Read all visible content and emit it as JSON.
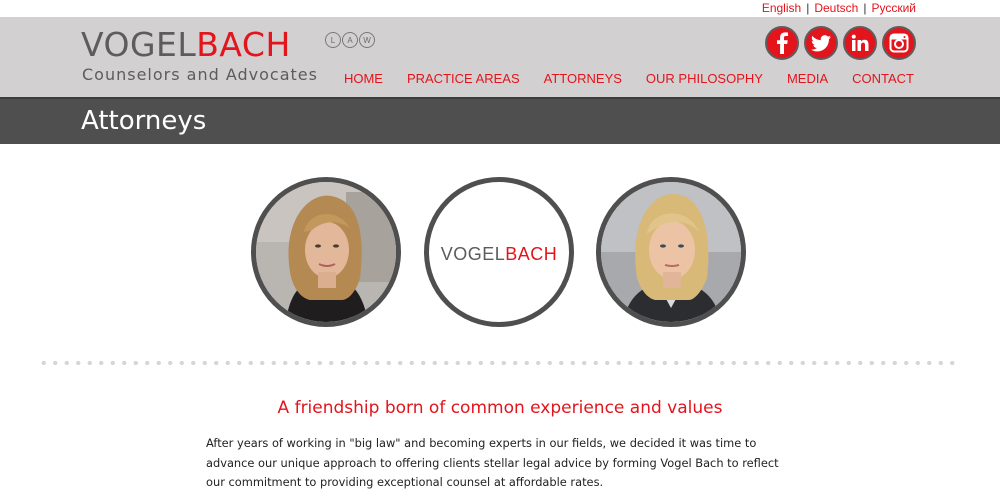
{
  "languages": [
    {
      "label": "English"
    },
    {
      "label": "Deutsch"
    },
    {
      "label": "Русский"
    }
  ],
  "logo": {
    "part1": "VOGEL",
    "part2": "BACH",
    "law_letters": [
      "L",
      "A",
      "W"
    ],
    "tagline": "Counselors and Advocates"
  },
  "social": [
    {
      "icon": "facebook-icon"
    },
    {
      "icon": "twitter-icon"
    },
    {
      "icon": "linkedin-icon"
    },
    {
      "icon": "instagram-icon"
    }
  ],
  "nav": [
    {
      "label": "HOME"
    },
    {
      "label": "PRACTICE AREAS"
    },
    {
      "label": "ATTORNEYS"
    },
    {
      "label": "OUR PHILOSOPHY"
    },
    {
      "label": "MEDIA"
    },
    {
      "label": "CONTACT"
    }
  ],
  "page_title": "Attorneys",
  "center_logo": {
    "part1": "VOGEL",
    "part2": "BACH"
  },
  "content": {
    "heading": "A friendship born of common experience and values",
    "paragraph": "After years of working in \"big law\" and becoming experts in our fields, we decided it was time to advance our unique approach to offering clients stellar legal advice by forming Vogel Bach to reflect our commitment to providing exceptional counsel at affordable rates."
  },
  "colors": {
    "accent": "#e3141c",
    "header_bg": "#d2d0d0",
    "title_band": "#4f4f4f",
    "logo_gray": "#5d5b5b"
  }
}
